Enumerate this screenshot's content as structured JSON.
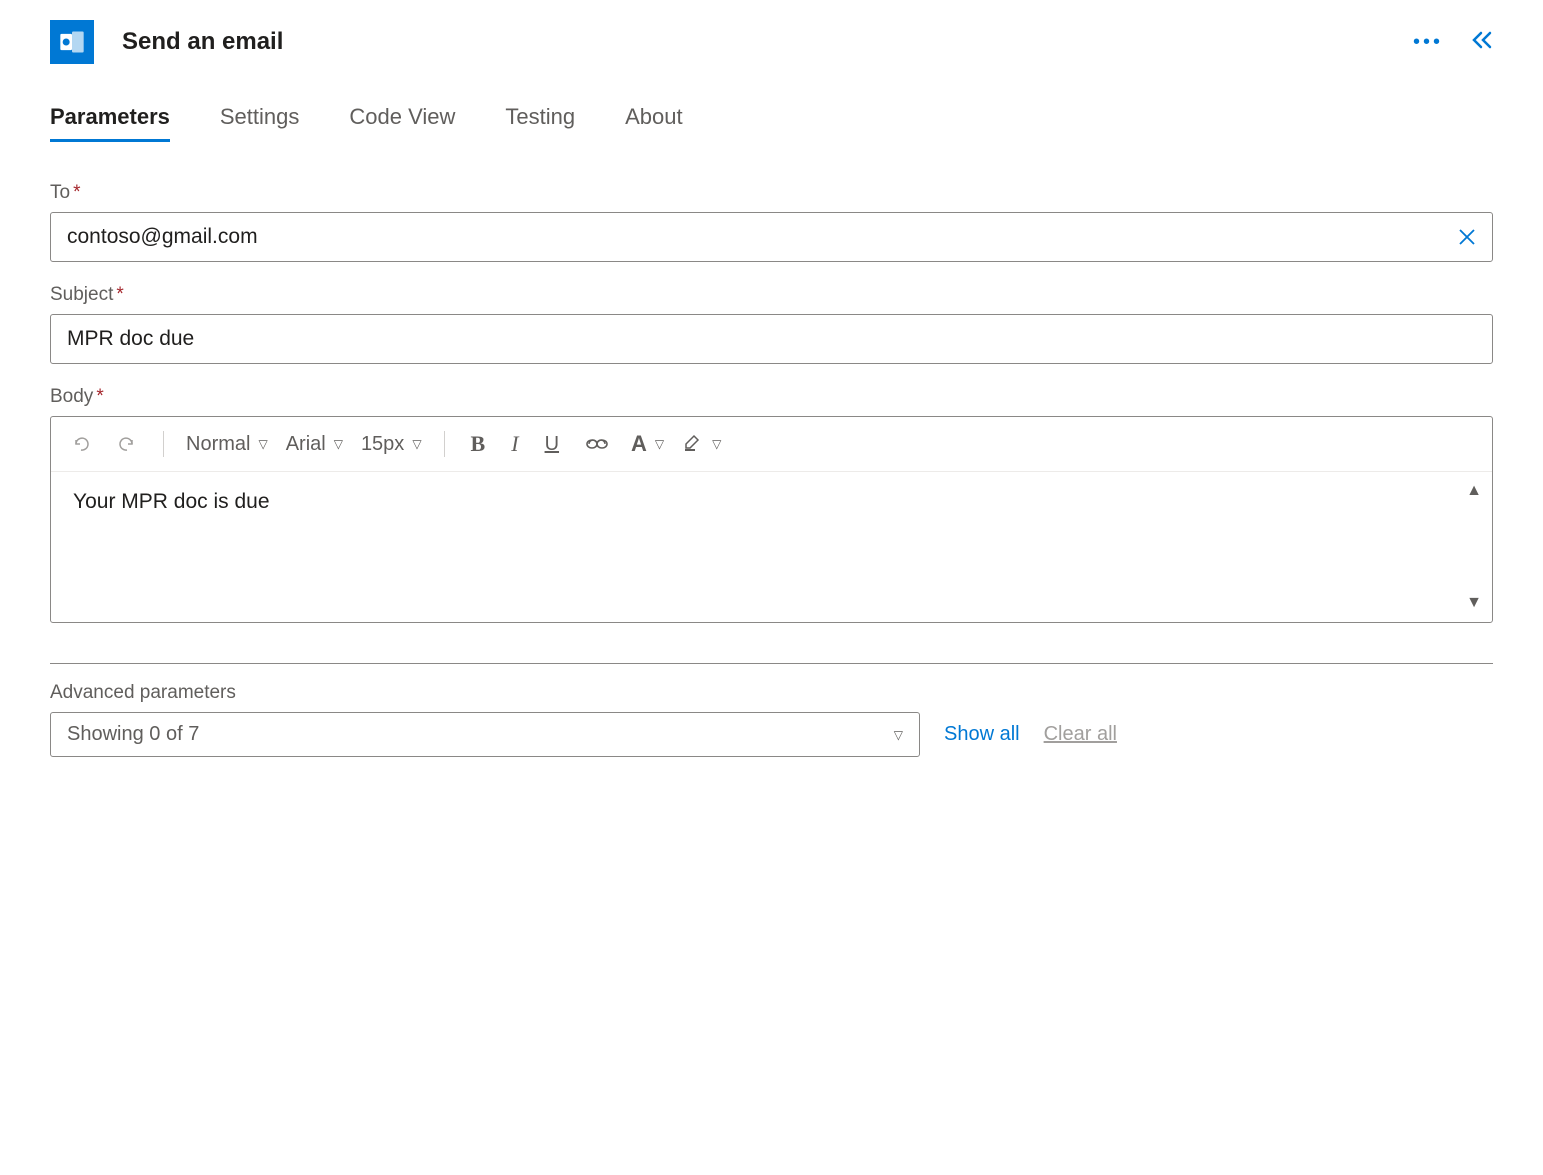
{
  "header": {
    "title": "Send an email"
  },
  "tabs": {
    "items": [
      "Parameters",
      "Settings",
      "Code View",
      "Testing",
      "About"
    ],
    "active": 0
  },
  "fields": {
    "to": {
      "label": "To",
      "value": "contoso@gmail.com"
    },
    "subject": {
      "label": "Subject",
      "value": "MPR doc due"
    },
    "body": {
      "label": "Body",
      "value": "Your MPR doc is due"
    }
  },
  "editor_toolbar": {
    "heading": "Normal",
    "font": "Arial",
    "size": "15px"
  },
  "advanced": {
    "label": "Advanced parameters",
    "select_text": "Showing 0 of 7",
    "show_all": "Show all",
    "clear_all": "Clear all"
  }
}
